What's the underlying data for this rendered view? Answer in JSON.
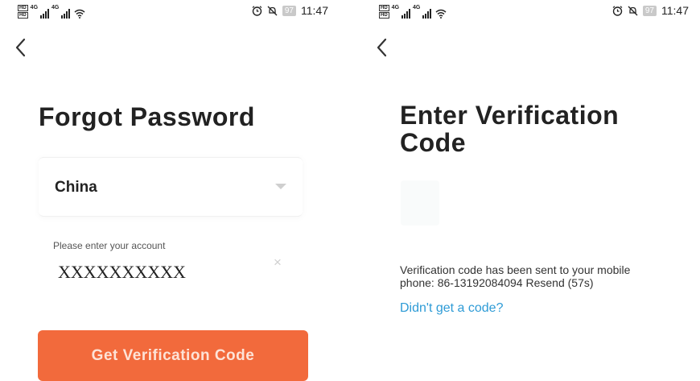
{
  "status": {
    "hd_top": "HD",
    "hd_bottom": "HD",
    "net_a": "4G",
    "net_b": "4G",
    "battery": "97",
    "time": "11:47"
  },
  "left": {
    "title": "Forgot Password",
    "country": "China",
    "account_label": "Please enter your account",
    "account_value": "XXXXXXXXXX",
    "clear": "×",
    "cta": "Get Verification Code"
  },
  "right": {
    "title_line1": "Enter Verification",
    "title_line2": "Code",
    "message_line1": "Verification code has been sent to your mobile",
    "message_line2": "phone: 86-13192084094 Resend (57s)",
    "link": "Didn't get a code?"
  },
  "colors": {
    "accent": "#f26a3c",
    "link": "#2e9bd6"
  }
}
